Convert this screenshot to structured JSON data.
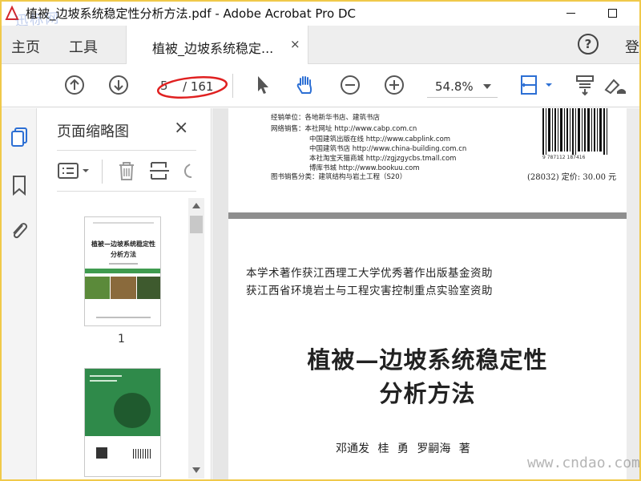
{
  "window": {
    "title": "植被_边坡系统稳定性分析方法.pdf - Adobe Acrobat Pro DC",
    "watermark_logo": "迅标网"
  },
  "menu": {
    "home": "主页",
    "tools": "工具",
    "tab_label": "植被_边坡系统稳定...",
    "tab_close": "×",
    "help": "?",
    "signin": "登"
  },
  "toolbar": {
    "current_page": "5",
    "page_total": "/ 161",
    "zoom": "54.8%",
    "icons": [
      "page-up-icon",
      "page-down-icon",
      "select-arrow-icon",
      "hand-icon",
      "zoom-out-icon",
      "zoom-in-icon",
      "fit-page-icon",
      "scroll-mode-icon",
      "sign-icon"
    ],
    "annotation_color": "#e02020"
  },
  "rail": {
    "icons": [
      "page-thumbnails-icon",
      "bookmark-icon",
      "attachment-icon"
    ],
    "active_color": "#2c6fd4"
  },
  "thumb_panel": {
    "title": "页面缩略图",
    "close": "×",
    "thumbs": [
      {
        "label": "1",
        "title_line1": "植被—边坡系统稳定性",
        "title_line2": "分析方法"
      },
      {
        "label": ""
      }
    ]
  },
  "page_top": {
    "lines": [
      "经销单位：各地新华书店、建筑书店",
      "网络销售：本社网址  http://www.cabp.com.cn",
      "中国建筑出版在线  http://www.cabplink.com",
      "中国建筑书店  http://www.china-building.com.cn",
      "本社淘宝天猫商城  http://zgjzgycbs.tmall.com",
      "博库书城  http://www.bookuu.com",
      "图书销售分类：建筑结构与岩土工程（S20）"
    ],
    "isbn": "9 787112 187416",
    "price": "(28032) 定价: 30.00 元"
  },
  "page_main": {
    "funding_1": "本学术著作获江西理工大学优秀著作出版基金资助",
    "funding_2": "获江西省环境岩土与工程灾害控制重点实验室资助",
    "title_1": "植被—边坡系统稳定性",
    "title_2": "分析方法",
    "authors": "邓通发  桂  勇  罗嗣海  著"
  },
  "watermark_site": "www.cndao.com"
}
